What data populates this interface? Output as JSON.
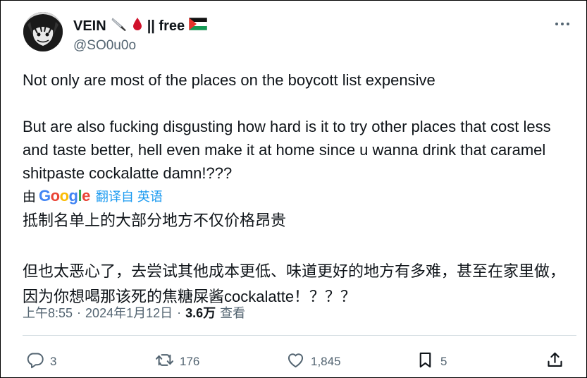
{
  "author": {
    "name": "VEIN",
    "name_suffix": "|| free",
    "handle": "@SO0u0o",
    "emojis": [
      "knife-icon",
      "blood-drop-icon",
      "palestine-flag-icon"
    ]
  },
  "tweet": {
    "text": "Not only are most of the places on the boycott list expensive\n\nBut are also fucking disgusting how hard is it to try other places that cost less and taste better, hell even make it at home since u wanna drink that caramel shitpaste cockalatte damn!???"
  },
  "translation": {
    "by_label": "由",
    "provider": "Google",
    "link_label": "翻译自 英语",
    "text": "抵制名单上的大部分地方不仅价格昂贵\n\n但也太恶心了，去尝试其他成本更低、味道更好的地方有多难，甚至在家里做，因为你想喝那该死的焦糖屎酱cockalatte！？？？"
  },
  "meta": {
    "time": "上午8:55",
    "separator": "·",
    "date": "2024年1月12日",
    "views_count": "3.6万",
    "views_label": "查看"
  },
  "actions": {
    "replies": "3",
    "reposts": "176",
    "likes": "1,845",
    "bookmarks": "5"
  },
  "colors": {
    "accent": "#1d9bf0",
    "secondary_text": "#536471",
    "border": "#cfd9de"
  }
}
